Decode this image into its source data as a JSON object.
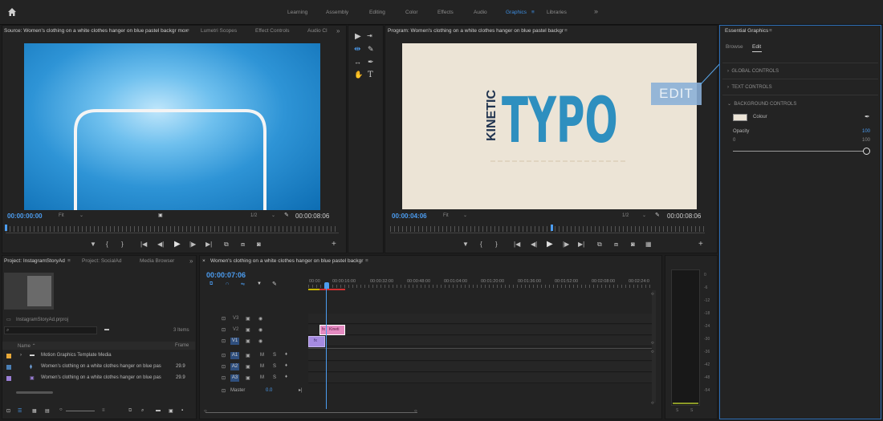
{
  "workspaces": [
    "Learning",
    "Assembly",
    "Editing",
    "Color",
    "Effects",
    "Audio",
    "Graphics",
    "Libraries"
  ],
  "active_workspace": "Graphics",
  "more_glyph": "»",
  "menu_glyph": "≡",
  "source": {
    "tab_title": "Source: Women's clothing on a white clothes hanger on blue pastel backgr mox",
    "tabs": [
      "Lumetri Scopes",
      "Effect Controls",
      "Audio Cl"
    ],
    "timecode_in": "00:00:00:00",
    "fit": "Fit",
    "resolution": "1/2",
    "timecode_out": "00:00:08:06"
  },
  "tools": [
    "▶",
    "⇥",
    "⇹",
    "✎",
    "↔",
    "✒",
    "✋",
    "T"
  ],
  "program": {
    "tab_title": "Program: Women's clothing on a white clothes hanger on blue pastel backgr",
    "timecode_in": "00:00:04:06",
    "fit": "Fit",
    "resolution": "1/2",
    "timecode_out": "00:00:08:06",
    "title_vertical": "KINETIC",
    "title_main": "TYPO",
    "edit_badge": "EDIT"
  },
  "essential_graphics": {
    "title": "Essential Graphics",
    "tabs": [
      "Browse",
      "Edit"
    ],
    "active_tab": "Edit",
    "sections": [
      "GLOBAL CONTROLS",
      "TEXT CONTROLS",
      "BACKGROUND CONTROLS"
    ],
    "colour_label": "Colour",
    "opacity_label": "Opacity",
    "opacity_value": "100",
    "slider_min": "0",
    "slider_max": "100",
    "swatch_color": "#ece4d6"
  },
  "project": {
    "tabs": [
      "Project: InstagramStoryAd",
      "Project: SocialAd",
      "Media Browser"
    ],
    "filename": "InstagramStoryAd.prproj",
    "items_count": "3 Items",
    "col_name": "Name",
    "col_rate": "Frame",
    "rows": [
      {
        "name": "Motion Graphics Template Media",
        "rate": "",
        "color": "#e8a838"
      },
      {
        "name": "Women's clothing on a white clothes hanger on blue pas",
        "rate": "29.9",
        "color": "#4a7fb5"
      },
      {
        "name": "Women's clothing on a white clothes hanger on blue pas",
        "rate": "29.9",
        "color": "#9b7fd6"
      }
    ]
  },
  "timeline": {
    "tab_title": "Women's clothing on a white clothes hanger on blue pastel backgr",
    "timecode": "00:00:07:06",
    "ruler": [
      "00:00",
      "00:00:16:00",
      "00:00:32:00",
      "00:00:48:00",
      "00:01:04:00",
      "00:01:20:00",
      "00:01:36:00",
      "00:01:52:00",
      "00:02:08:00",
      "00:02:24:0"
    ],
    "video_tracks": [
      "V3",
      "V2",
      "V1"
    ],
    "audio_tracks": [
      "A1",
      "A2",
      "A3"
    ],
    "audio_buttons": [
      "M",
      "S"
    ],
    "master_label": "Master",
    "master_value": "0.0",
    "clip_label": "Kineti"
  },
  "meter": {
    "scale": [
      "0",
      "-6",
      "-12",
      "-18",
      "-24",
      "-30",
      "-36",
      "-42",
      "-48",
      "-54"
    ],
    "channels": [
      "S",
      "S"
    ]
  }
}
